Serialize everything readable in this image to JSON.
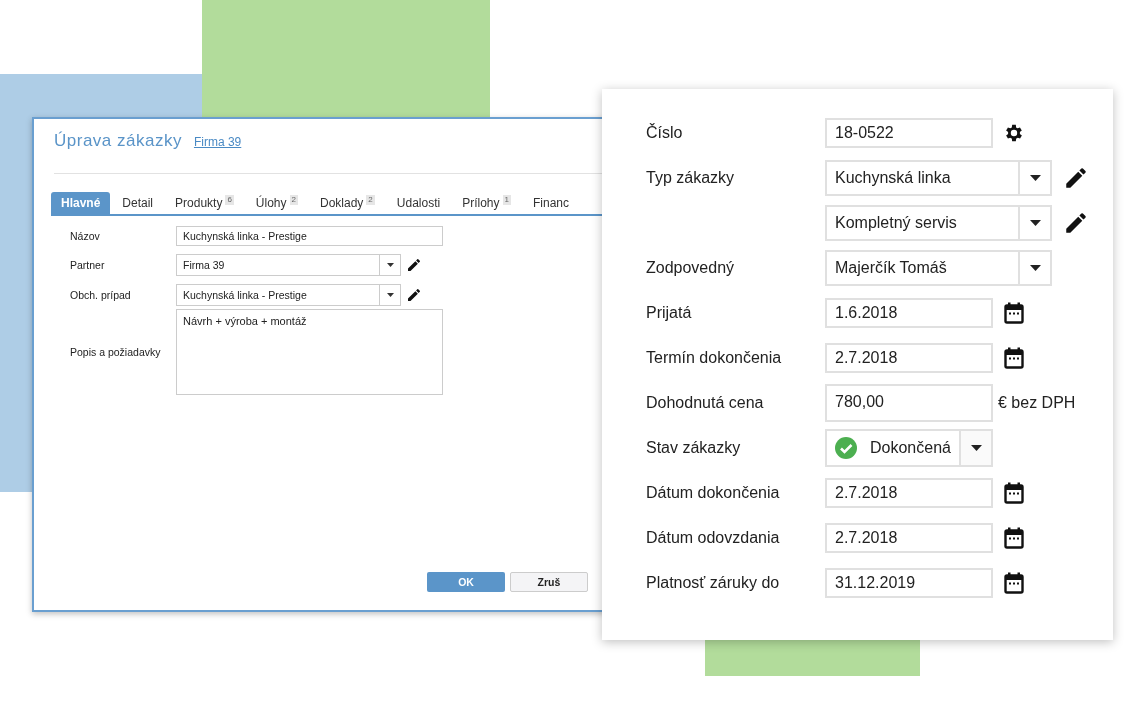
{
  "order_dialog": {
    "title": "Úprava zákazky",
    "partner_link": "Firma 39",
    "tabs": [
      {
        "label": "Hlavné",
        "selected": true
      },
      {
        "label": "Detail",
        "selected": false
      },
      {
        "label": "Produkty",
        "count": "6",
        "selected": false
      },
      {
        "label": "Úlohy",
        "count": "2",
        "selected": false
      },
      {
        "label": "Doklady",
        "count": "2",
        "selected": false
      },
      {
        "label": "Udalosti",
        "selected": false
      },
      {
        "label": "Prílohy",
        "count": "1",
        "selected": false
      },
      {
        "label": "Financ",
        "selected": false
      }
    ],
    "fields": [
      {
        "label": "Názov",
        "kind": "text",
        "value": "Kuchynská linka - Prestige"
      },
      {
        "label": "Partner",
        "kind": "select",
        "value": "Firma 39"
      },
      {
        "label": "Obch. prípad",
        "kind": "select",
        "value": "Kuchynská linka - Prestige"
      },
      {
        "label": "Popis a požiadavky",
        "kind": "textarea",
        "value": "Návrh + výroba + montáž"
      }
    ],
    "buttons": {
      "ok": "OK",
      "cancel": "Zruš"
    }
  },
  "detail_panel": {
    "fields": [
      {
        "label": "Číslo",
        "kind": "numbered",
        "value": "18-0522"
      },
      {
        "label": "Typ zákazky",
        "kind": "select_edit",
        "value": "Kuchynská linka"
      },
      {
        "kind": "select_edit",
        "value": "Kompletný servis"
      },
      {
        "label": "Zodpovedný",
        "kind": "select",
        "value": "Majerčík Tomáš"
      },
      {
        "label": "Prijatá",
        "kind": "date",
        "value": "1.6.2018"
      },
      {
        "label": "Termín dokončenia",
        "kind": "date",
        "value": "2.7.2018"
      },
      {
        "label": "Dohodnutá cena",
        "kind": "amount",
        "value": "780,00",
        "suffix": "€ bez DPH"
      },
      {
        "label": "Stav zákazky",
        "kind": "status",
        "value": "Dokončená"
      },
      {
        "label": "Dátum dokončenia",
        "kind": "date",
        "value": "2.7.2018"
      },
      {
        "label": "Dátum odovzdania",
        "kind": "date",
        "value": "2.7.2018"
      },
      {
        "label": "Platnosť záruky do",
        "kind": "date",
        "value": "31.12.2019"
      }
    ]
  }
}
